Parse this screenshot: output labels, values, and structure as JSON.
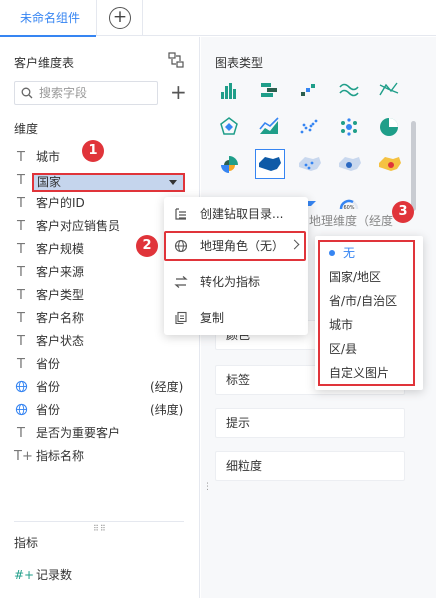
{
  "tabs": {
    "active": "未命名组件",
    "add_symbol": "+"
  },
  "left_panel": {
    "title": "客户维度表",
    "search_placeholder": "搜索字段",
    "add_symbol": "+",
    "dimensions_label": "维度",
    "dimensions": [
      {
        "type": "T",
        "name": "城市",
        "suffix": ""
      },
      {
        "type": "T",
        "name": "国家",
        "suffix": ""
      },
      {
        "type": "T",
        "name": "客户的ID",
        "suffix": ""
      },
      {
        "type": "T",
        "name": "客户对应销售员",
        "suffix": ""
      },
      {
        "type": "T",
        "name": "客户规模",
        "suffix": ""
      },
      {
        "type": "T",
        "name": "客户来源",
        "suffix": ""
      },
      {
        "type": "T",
        "name": "客户类型",
        "suffix": ""
      },
      {
        "type": "T",
        "name": "客户名称",
        "suffix": ""
      },
      {
        "type": "T",
        "name": "客户状态",
        "suffix": ""
      },
      {
        "type": "T",
        "name": "省份",
        "suffix": ""
      },
      {
        "type": "globe",
        "name": "省份",
        "suffix": "(经度)"
      },
      {
        "type": "globe",
        "name": "省份",
        "suffix": "(纬度)"
      },
      {
        "type": "T",
        "name": "是否为重要客户",
        "suffix": ""
      },
      {
        "type": "T+",
        "name": "指标名称",
        "suffix": ""
      }
    ],
    "measures_label": "指标",
    "measures": [
      {
        "type": "#+",
        "name": "记录数"
      }
    ]
  },
  "right_panel": {
    "title": "图表类型",
    "ghost_text": "地理维度（经度",
    "property_boxes": [
      "颜色",
      "标签",
      "提示",
      "细粒度"
    ],
    "gauge_label": "60%"
  },
  "context_menu": {
    "items": [
      {
        "label": "创建钻取目录...",
        "icon": "drill-icon"
      },
      {
        "label": "地理角色（无）",
        "icon": "globe-icon",
        "has_submenu": true
      },
      {
        "label": "转化为指标",
        "icon": "convert-icon"
      },
      {
        "label": "复制",
        "icon": "copy-icon"
      }
    ]
  },
  "geo_submenu": {
    "items": [
      "无",
      "国家/地区",
      "省/市/自治区",
      "城市",
      "区/县",
      "自定义图片"
    ],
    "selected": "无"
  },
  "annotations": [
    "1",
    "2",
    "3"
  ],
  "colors": {
    "accent": "#3685f2",
    "highlight_red": "#e0343a",
    "selected_bg": "#c5d5ed",
    "chart_green": "#1f9e89",
    "chart_blue": "#3685f2",
    "chart_orange": "#f5a623"
  }
}
